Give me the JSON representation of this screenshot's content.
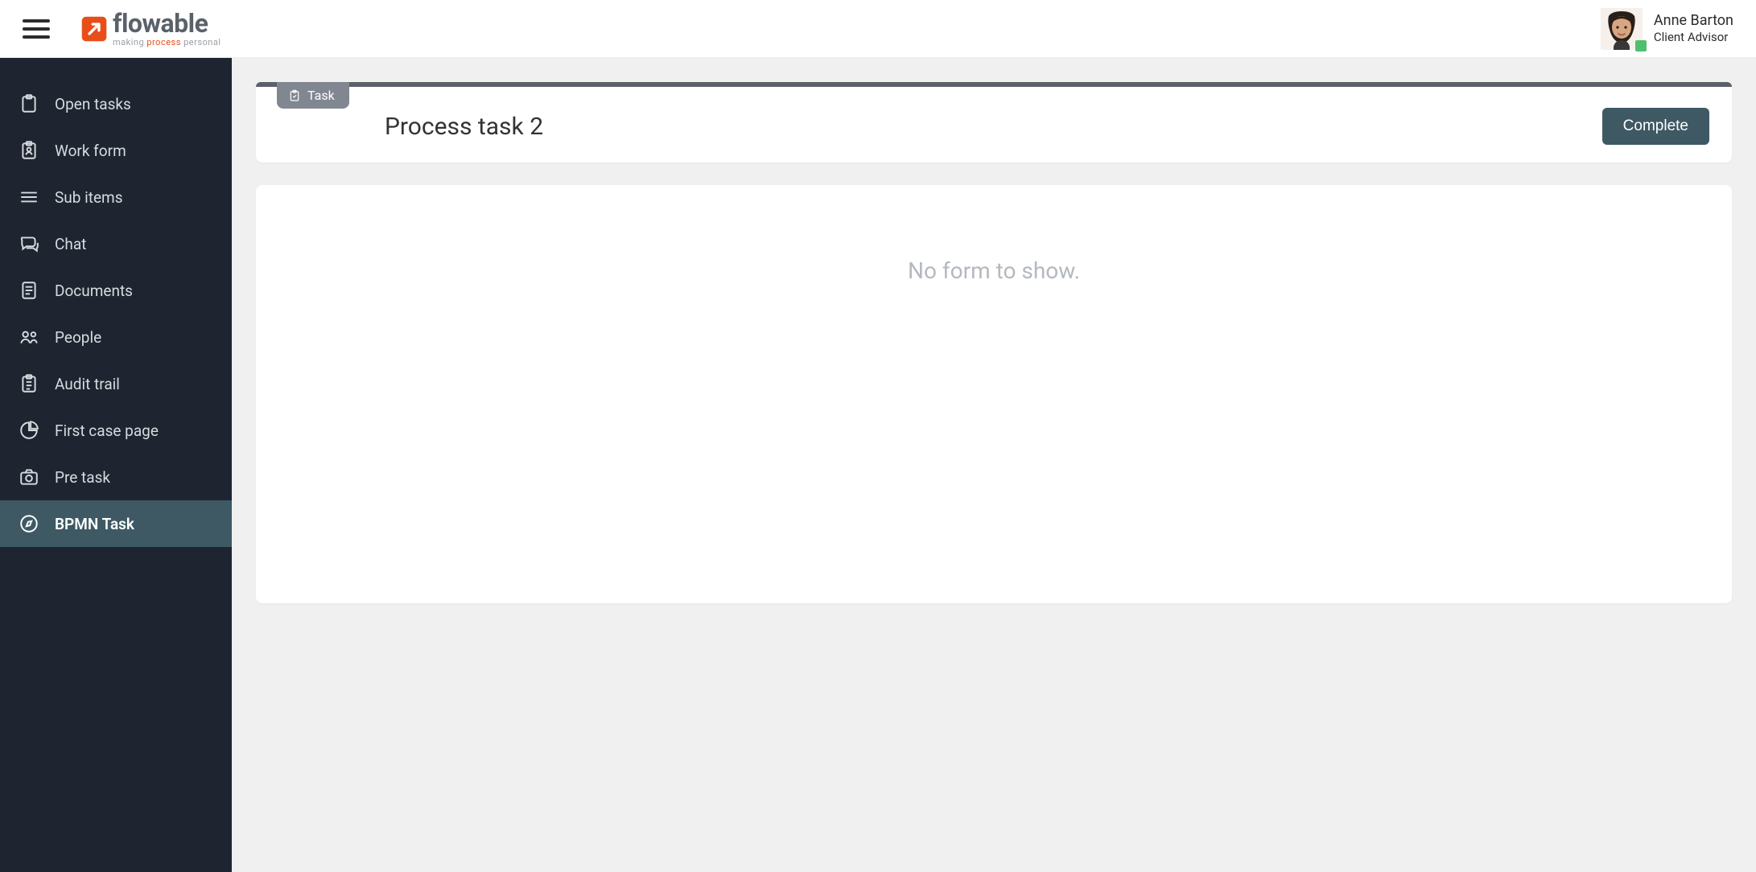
{
  "header": {
    "brand": "flowable",
    "tagline_pre": "making ",
    "tagline_em": "process",
    "tagline_post": " personal",
    "user_name": "Anne Barton",
    "user_role": "Client Advisor"
  },
  "sidebar": {
    "items": [
      {
        "label": "Open tasks",
        "icon": "clipboard-icon",
        "active": false
      },
      {
        "label": "Work form",
        "icon": "badge-icon",
        "active": false
      },
      {
        "label": "Sub items",
        "icon": "list-icon",
        "active": false
      },
      {
        "label": "Chat",
        "icon": "chat-icon",
        "active": false
      },
      {
        "label": "Documents",
        "icon": "document-icon",
        "active": false
      },
      {
        "label": "People",
        "icon": "people-icon",
        "active": false
      },
      {
        "label": "Audit trail",
        "icon": "checklist-icon",
        "active": false
      },
      {
        "label": "First case page",
        "icon": "pie-icon",
        "active": false
      },
      {
        "label": "Pre task",
        "icon": "camera-icon",
        "active": false
      },
      {
        "label": "BPMN Task",
        "icon": "compass-icon",
        "active": true
      }
    ]
  },
  "task": {
    "tag_label": "Task",
    "title": "Process task 2",
    "complete_label": "Complete"
  },
  "content": {
    "empty_message": "No form to show."
  }
}
